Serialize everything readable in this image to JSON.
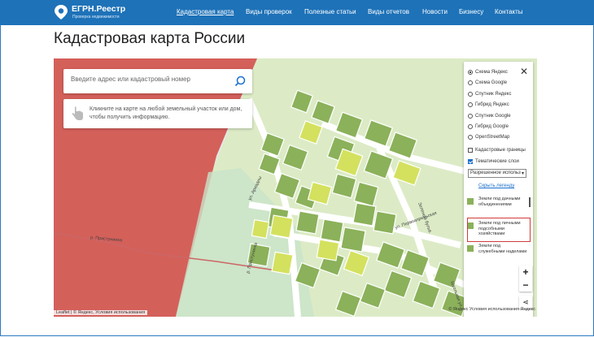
{
  "header": {
    "logo_title": "ЕГРН.Реестр",
    "logo_subtitle": "Проверка недвижимости",
    "nav": [
      {
        "label": "Кадастровая карта",
        "active": true
      },
      {
        "label": "Виды проверок",
        "active": false
      },
      {
        "label": "Полезные статьи",
        "active": false
      },
      {
        "label": "Виды отчетов",
        "active": false
      },
      {
        "label": "Новости",
        "active": false
      },
      {
        "label": "Бизнесу",
        "active": false
      },
      {
        "label": "Контакты",
        "active": false
      }
    ]
  },
  "page_title": "Кадастровая карта России",
  "map": {
    "search_placeholder": "Введите адрес или кадастровый номер",
    "hint_text": "Кликните на карте на любой земельный участок или дом, чтобы получить информацию.",
    "streets": {
      "ariadna": "ул. Ариадны",
      "pervo": "ул. Первоапрельская",
      "zeleny": "Зеленый бульв.",
      "shkolnaya": "Школьная ул.",
      "pristupinka_1": "р. Пристунинка",
      "pristupinka_2": "р. Пристунинка"
    },
    "zoom_in": "+",
    "zoom_out": "−",
    "attribution_left": "Leaflet | © Яндекс, Условия использования",
    "attribution_right": "© Яндекс Условия использования Яндекс",
    "colors": {
      "red_zone": "#d4605a",
      "light_green": "#dcebc6",
      "green_parcel": "#8bb15a",
      "yellow_parcel": "#d4e15e",
      "road": "#ffffff"
    }
  },
  "layers_panel": {
    "base_layers": [
      {
        "label": "Схема Яндекс",
        "selected": true
      },
      {
        "label": "Схема Google",
        "selected": false
      },
      {
        "label": "Спутник Яндекс",
        "selected": false
      },
      {
        "label": "Гибрид Яндекс",
        "selected": false
      },
      {
        "label": "Спутник Google",
        "selected": false
      },
      {
        "label": "Гибрид Google",
        "selected": false
      },
      {
        "label": "OpenStreetMap",
        "selected": false
      }
    ],
    "overlays": [
      {
        "label": "Кадастровые границы",
        "checked": false
      },
      {
        "label": "Тематические слои",
        "checked": true
      }
    ],
    "select_value": "Разрешенное использ",
    "hide_legend": "Скрыть легенду",
    "legend": [
      {
        "label": "Земли под дачными объединениями",
        "color": "#8bb15a"
      },
      {
        "label": "Земли под личными подсобными хозяйствами",
        "color": "#8bb15a"
      },
      {
        "label": "Земли под служебными наделами",
        "color": "#8bb15a"
      }
    ]
  }
}
